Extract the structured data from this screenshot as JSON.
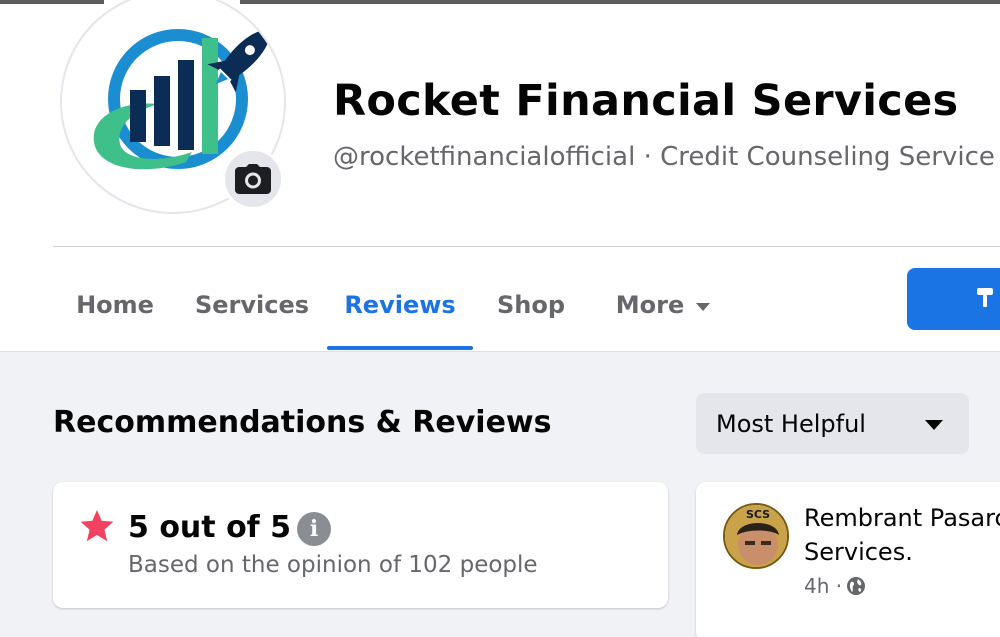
{
  "page": {
    "title": "Rocket Financial Services",
    "subtitle": "@rocketfinancialofficial · Credit Counseling Service"
  },
  "tabs": [
    {
      "label": "Home",
      "active": false
    },
    {
      "label": "Services",
      "active": false
    },
    {
      "label": "Reviews",
      "active": true
    },
    {
      "label": "Shop",
      "active": false
    },
    {
      "label": "More",
      "active": false
    }
  ],
  "reviews_section": {
    "title": "Recommendations & Reviews",
    "sort": {
      "selected": "Most Helpful"
    },
    "rating": {
      "score_text": "5 out of 5",
      "basis_text": "Based on the opinion of 102 people"
    },
    "first_review": {
      "author": "Rembrant Pasarc",
      "text_line": "Services.",
      "time": "4h ·",
      "avatar_badge": "SCS"
    }
  },
  "icons": {
    "camera": "camera-icon",
    "star": "star-icon",
    "info": "info-icon",
    "globe": "globe-icon",
    "caret": "caret-down-icon"
  },
  "colors": {
    "accent": "#1b74e4",
    "star": "#f3425f",
    "secondary_text": "#65676b",
    "page_bg": "#f0f2f5",
    "logo_navy": "#0b2c55",
    "logo_blue": "#1b8ed1",
    "logo_green": "#3fbf8a"
  }
}
